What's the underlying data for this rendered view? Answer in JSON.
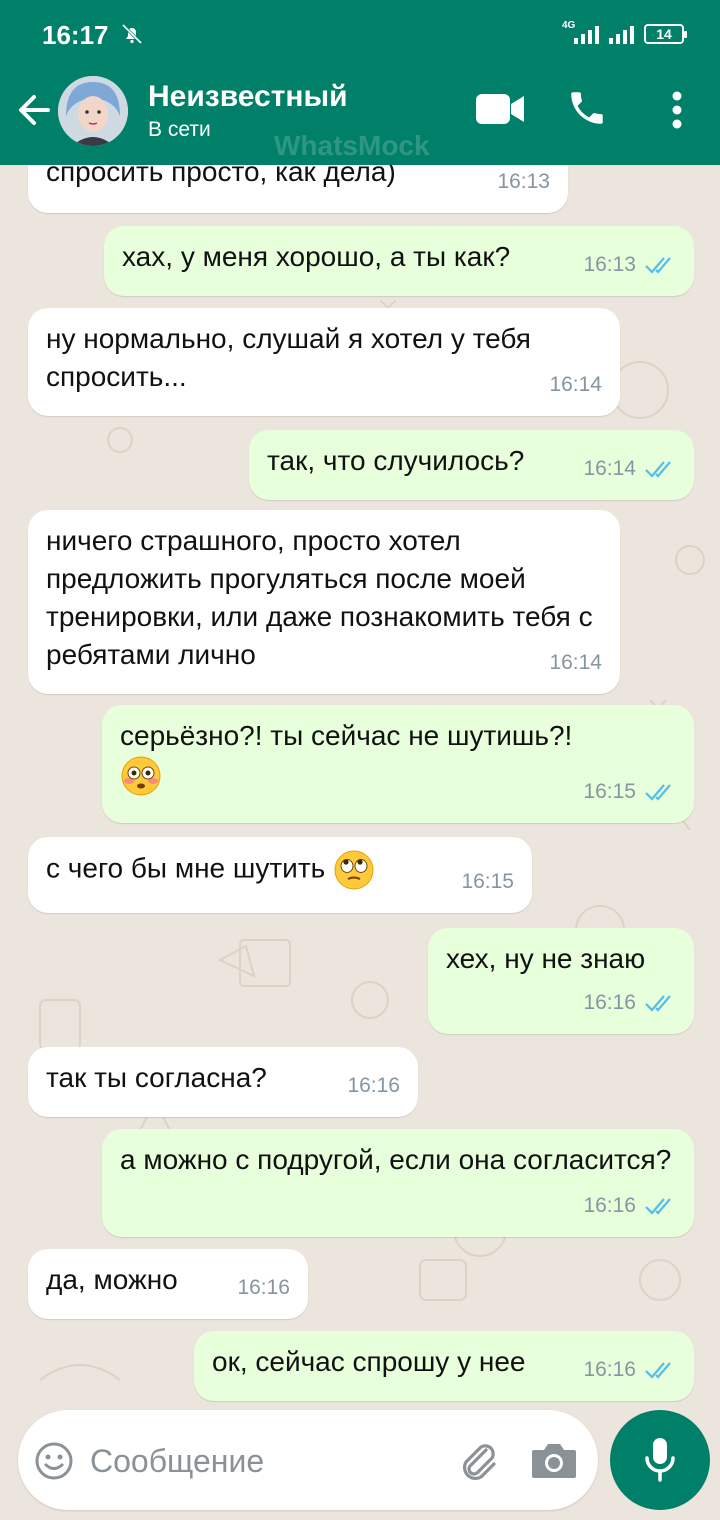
{
  "status_bar": {
    "time": "16:17",
    "network": "4G",
    "battery": "14"
  },
  "header": {
    "contact_name": "Неизвестный",
    "contact_status": "В сети",
    "watermark": "WhatsMock"
  },
  "messages": [
    {
      "dir": "in",
      "text": "спросить просто, как дела)",
      "time": "16:13"
    },
    {
      "dir": "out",
      "text": "хах, у меня хорошо, а ты как?",
      "time": "16:13",
      "read": true
    },
    {
      "dir": "in",
      "text": "ну нормально, слушай я хотел у тебя спросить...",
      "time": "16:14"
    },
    {
      "dir": "out",
      "text": "так, что случилось?",
      "time": "16:14",
      "read": true
    },
    {
      "dir": "in",
      "text": "ничего страшного, просто хотел предложить прогуляться после моей тренировки, или даже познакомить тебя с ребятами лично",
      "time": "16:14"
    },
    {
      "dir": "out",
      "text": "серьёзно?! ты сейчас не шутишь?!",
      "emoji": "flushed-face",
      "time": "16:15",
      "read": true
    },
    {
      "dir": "in",
      "text": "с чего бы мне шутить",
      "emoji": "eye-roll-face",
      "time": "16:15"
    },
    {
      "dir": "out",
      "text": "хех, ну не знаю",
      "time": "16:16",
      "read": true
    },
    {
      "dir": "in",
      "text": "так ты согласна?",
      "time": "16:16"
    },
    {
      "dir": "out",
      "text": "а можно с подругой, если она согласится?",
      "time": "16:16",
      "read": true
    },
    {
      "dir": "in",
      "text": "да, можно",
      "time": "16:16"
    },
    {
      "dir": "out",
      "text": "ок, сейчас спрошу у нее",
      "time": "16:16",
      "read": true
    }
  ],
  "input": {
    "placeholder": "Сообщение"
  },
  "colors": {
    "header": "#008069",
    "incoming": "#ffffff",
    "outgoing": "#e7ffdb",
    "read_ticks": "#53bdeb"
  }
}
